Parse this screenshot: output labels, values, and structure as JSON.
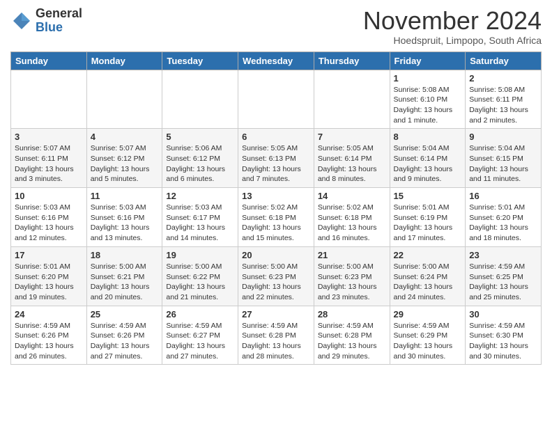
{
  "header": {
    "logo_general": "General",
    "logo_blue": "Blue",
    "month_title": "November 2024",
    "location": "Hoedspruit, Limpopo, South Africa"
  },
  "days_of_week": [
    "Sunday",
    "Monday",
    "Tuesday",
    "Wednesday",
    "Thursday",
    "Friday",
    "Saturday"
  ],
  "weeks": [
    [
      {
        "day": "",
        "info": ""
      },
      {
        "day": "",
        "info": ""
      },
      {
        "day": "",
        "info": ""
      },
      {
        "day": "",
        "info": ""
      },
      {
        "day": "",
        "info": ""
      },
      {
        "day": "1",
        "info": "Sunrise: 5:08 AM\nSunset: 6:10 PM\nDaylight: 13 hours and 1 minute."
      },
      {
        "day": "2",
        "info": "Sunrise: 5:08 AM\nSunset: 6:11 PM\nDaylight: 13 hours and 2 minutes."
      }
    ],
    [
      {
        "day": "3",
        "info": "Sunrise: 5:07 AM\nSunset: 6:11 PM\nDaylight: 13 hours and 3 minutes."
      },
      {
        "day": "4",
        "info": "Sunrise: 5:07 AM\nSunset: 6:12 PM\nDaylight: 13 hours and 5 minutes."
      },
      {
        "day": "5",
        "info": "Sunrise: 5:06 AM\nSunset: 6:12 PM\nDaylight: 13 hours and 6 minutes."
      },
      {
        "day": "6",
        "info": "Sunrise: 5:05 AM\nSunset: 6:13 PM\nDaylight: 13 hours and 7 minutes."
      },
      {
        "day": "7",
        "info": "Sunrise: 5:05 AM\nSunset: 6:14 PM\nDaylight: 13 hours and 8 minutes."
      },
      {
        "day": "8",
        "info": "Sunrise: 5:04 AM\nSunset: 6:14 PM\nDaylight: 13 hours and 9 minutes."
      },
      {
        "day": "9",
        "info": "Sunrise: 5:04 AM\nSunset: 6:15 PM\nDaylight: 13 hours and 11 minutes."
      }
    ],
    [
      {
        "day": "10",
        "info": "Sunrise: 5:03 AM\nSunset: 6:16 PM\nDaylight: 13 hours and 12 minutes."
      },
      {
        "day": "11",
        "info": "Sunrise: 5:03 AM\nSunset: 6:16 PM\nDaylight: 13 hours and 13 minutes."
      },
      {
        "day": "12",
        "info": "Sunrise: 5:03 AM\nSunset: 6:17 PM\nDaylight: 13 hours and 14 minutes."
      },
      {
        "day": "13",
        "info": "Sunrise: 5:02 AM\nSunset: 6:18 PM\nDaylight: 13 hours and 15 minutes."
      },
      {
        "day": "14",
        "info": "Sunrise: 5:02 AM\nSunset: 6:18 PM\nDaylight: 13 hours and 16 minutes."
      },
      {
        "day": "15",
        "info": "Sunrise: 5:01 AM\nSunset: 6:19 PM\nDaylight: 13 hours and 17 minutes."
      },
      {
        "day": "16",
        "info": "Sunrise: 5:01 AM\nSunset: 6:20 PM\nDaylight: 13 hours and 18 minutes."
      }
    ],
    [
      {
        "day": "17",
        "info": "Sunrise: 5:01 AM\nSunset: 6:20 PM\nDaylight: 13 hours and 19 minutes."
      },
      {
        "day": "18",
        "info": "Sunrise: 5:00 AM\nSunset: 6:21 PM\nDaylight: 13 hours and 20 minutes."
      },
      {
        "day": "19",
        "info": "Sunrise: 5:00 AM\nSunset: 6:22 PM\nDaylight: 13 hours and 21 minutes."
      },
      {
        "day": "20",
        "info": "Sunrise: 5:00 AM\nSunset: 6:23 PM\nDaylight: 13 hours and 22 minutes."
      },
      {
        "day": "21",
        "info": "Sunrise: 5:00 AM\nSunset: 6:23 PM\nDaylight: 13 hours and 23 minutes."
      },
      {
        "day": "22",
        "info": "Sunrise: 5:00 AM\nSunset: 6:24 PM\nDaylight: 13 hours and 24 minutes."
      },
      {
        "day": "23",
        "info": "Sunrise: 4:59 AM\nSunset: 6:25 PM\nDaylight: 13 hours and 25 minutes."
      }
    ],
    [
      {
        "day": "24",
        "info": "Sunrise: 4:59 AM\nSunset: 6:26 PM\nDaylight: 13 hours and 26 minutes."
      },
      {
        "day": "25",
        "info": "Sunrise: 4:59 AM\nSunset: 6:26 PM\nDaylight: 13 hours and 27 minutes."
      },
      {
        "day": "26",
        "info": "Sunrise: 4:59 AM\nSunset: 6:27 PM\nDaylight: 13 hours and 27 minutes."
      },
      {
        "day": "27",
        "info": "Sunrise: 4:59 AM\nSunset: 6:28 PM\nDaylight: 13 hours and 28 minutes."
      },
      {
        "day": "28",
        "info": "Sunrise: 4:59 AM\nSunset: 6:28 PM\nDaylight: 13 hours and 29 minutes."
      },
      {
        "day": "29",
        "info": "Sunrise: 4:59 AM\nSunset: 6:29 PM\nDaylight: 13 hours and 30 minutes."
      },
      {
        "day": "30",
        "info": "Sunrise: 4:59 AM\nSunset: 6:30 PM\nDaylight: 13 hours and 30 minutes."
      }
    ]
  ]
}
